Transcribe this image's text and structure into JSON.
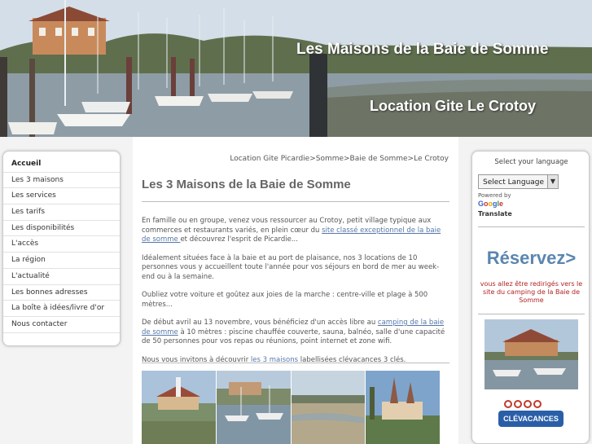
{
  "header": {
    "title": "Les Maisons de la Baie de Somme",
    "subtitle": "Location Gite Le Crotoy"
  },
  "nav": {
    "items": [
      {
        "label": "Accueil",
        "active": true
      },
      {
        "label": "Les 3 maisons"
      },
      {
        "label": "Les services"
      },
      {
        "label": "Les tarifs"
      },
      {
        "label": "Les disponibilités"
      },
      {
        "label": "L'accès"
      },
      {
        "label": "La région"
      },
      {
        "label": "L'actualité"
      },
      {
        "label": "Les bonnes adresses"
      },
      {
        "label": "La boîte à idées/livre d'or"
      },
      {
        "label": "Nous contacter"
      }
    ]
  },
  "breadcrumb": "Location Gite Picardie>Somme>Baie de Somme>Le Crotoy",
  "main": {
    "title": "Les 3 Maisons de la Baie de Somme",
    "p1_a": "En famille ou en groupe, venez vous ressourcer au Crotoy, petit village typique aux commerces et restaurants variés, en plein cœur du ",
    "p1_link": "site classé exceptionnel de la baie de somme ",
    "p1_b": " et découvrez l'esprit de Picardie...",
    "p2": "Idéalement situées face à la baie et au port de plaisance, nos 3 locations de 10 personnes vous y accueillent toute l'année pour vos séjours en bord de mer au week-end ou à la semaine.",
    "p3": "Oubliez votre voiture et goûtez aux joies de la marche : centre-ville et  plage à 500 mètres...",
    "p4_a": "De début avril au 13 novembre, vous bénéficiez d'un accès libre au ",
    "p4_link": "camping de la baie de somme",
    "p4_b": " à 10 mètres : piscine chauffée couverte, sauna, balnéo, salle d'une capacité de 50 personnes pour vos repas ou réunions, point internet et zone wifi.",
    "p5_a": "Nous vous invitons à découvrir ",
    "p5_link": "les 3 maisons",
    "p5_b": " labellisées clévacances 3 clés."
  },
  "sidebar": {
    "language_title": "Select your language",
    "language_select": "Select Language",
    "powered_by": "Powered by",
    "google": "Google",
    "translate": "Translate",
    "reservez": "Réservez>",
    "redirect_note": "vous allez être redirigés vers le site du camping de la Baie de Somme",
    "clevacances_label": "CLÉVACANCES"
  },
  "colors": {
    "link": "#5577aa",
    "reservez": "#5b86b0",
    "redirect_note": "#b22222"
  }
}
